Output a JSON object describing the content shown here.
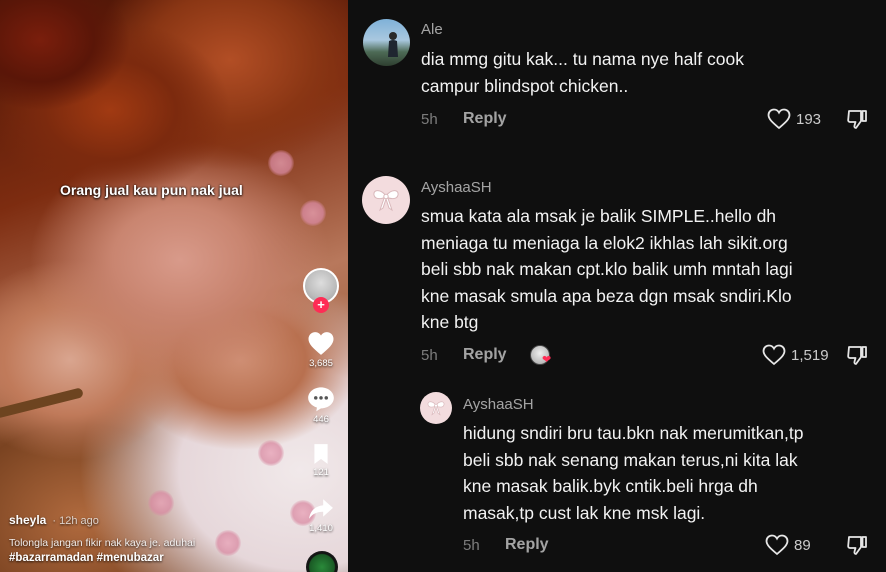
{
  "video": {
    "overlay_caption": "Orang jual kau pun nak jual",
    "username": "sheyla",
    "posted_ago": "· 12h ago",
    "description": "Tolongla jangan fikir nak kaya je. aduhai",
    "hashtags": "#bazarramadan #menubazar",
    "likes": "3,685",
    "comments": "446",
    "saves": "121",
    "shares": "1,410"
  },
  "comments": [
    {
      "author": "Ale",
      "text": "dia mmg gitu kak... tu nama nye half cook\ncampur blindspot chicken..",
      "ago": "5h",
      "reply_label": "Reply",
      "likes": "193"
    },
    {
      "author": "AyshaaSH",
      "text": "smua kata ala msak je balik SIMPLE..hello dh\nmeniaga tu meniaga la elok2 ikhlas lah sikit.org\nbeli sbb nak makan cpt.klo balik umh mntah lagi\nkne masak smula apa beza dgn msak sndiri.Klo\nkne btg",
      "ago": "5h",
      "reply_label": "Reply",
      "likes": "1,519"
    },
    {
      "author": "AyshaaSH",
      "text": "hidung sndiri bru tau.bkn nak merumitkan,tp\nbeli sbb nak senang makan terus,ni kita lak\nkne masak balik.byk cntik.beli hrga dh\nmasak,tp cust lak kne msk lagi.",
      "ago": "5h",
      "reply_label": "Reply",
      "likes": "89"
    }
  ],
  "colors": {
    "accent_red": "#fe2c55",
    "panel_bg": "#0f0f0f"
  },
  "icons": [
    "heart-icon",
    "comment-bubble-icon",
    "bookmark-icon",
    "share-icon",
    "dislike-icon",
    "bow-icon",
    "plus-icon"
  ]
}
